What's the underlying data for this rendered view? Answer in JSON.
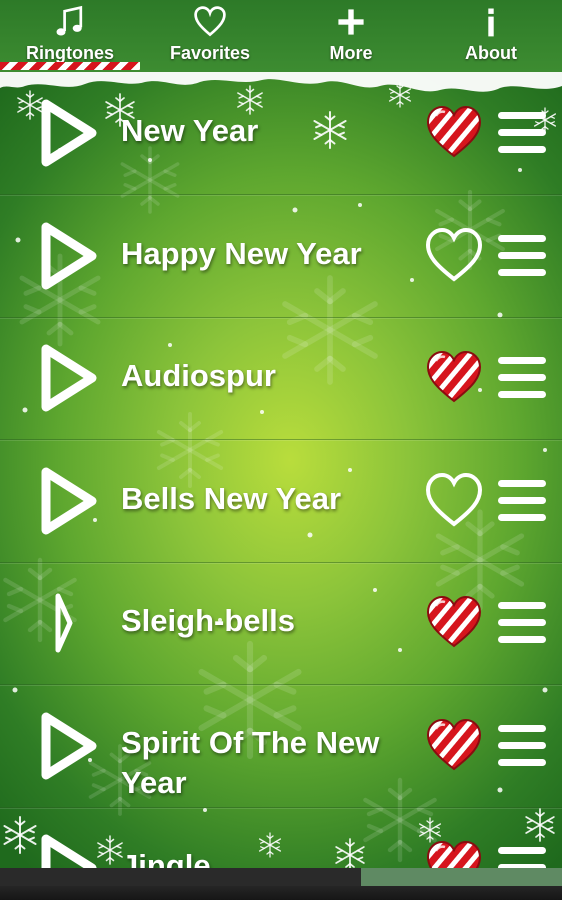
{
  "tabs": [
    {
      "label": "Ringtones",
      "icon": "music-note-icon",
      "selected": true
    },
    {
      "label": "Favorites",
      "icon": "heart-outline-icon",
      "selected": false
    },
    {
      "label": "More",
      "icon": "plus-icon",
      "selected": false
    },
    {
      "label": "About",
      "icon": "info-icon",
      "selected": false
    }
  ],
  "ringtones": [
    {
      "title": "New Year",
      "favorite": true
    },
    {
      "title": "Happy New Year",
      "favorite": false
    },
    {
      "title": "Audiospur",
      "favorite": true
    },
    {
      "title": "Bells New Year",
      "favorite": false
    },
    {
      "title": "Sleigh-bells",
      "favorite": true
    },
    {
      "title": "Spirit Of The New Year",
      "favorite": true
    },
    {
      "title": "Jingle",
      "favorite": true
    }
  ],
  "colors": {
    "background_green": "#5ea72f",
    "candy_red": "#d6151d",
    "text": "#ffffff"
  },
  "player": {
    "progress_fraction": 0.36
  }
}
